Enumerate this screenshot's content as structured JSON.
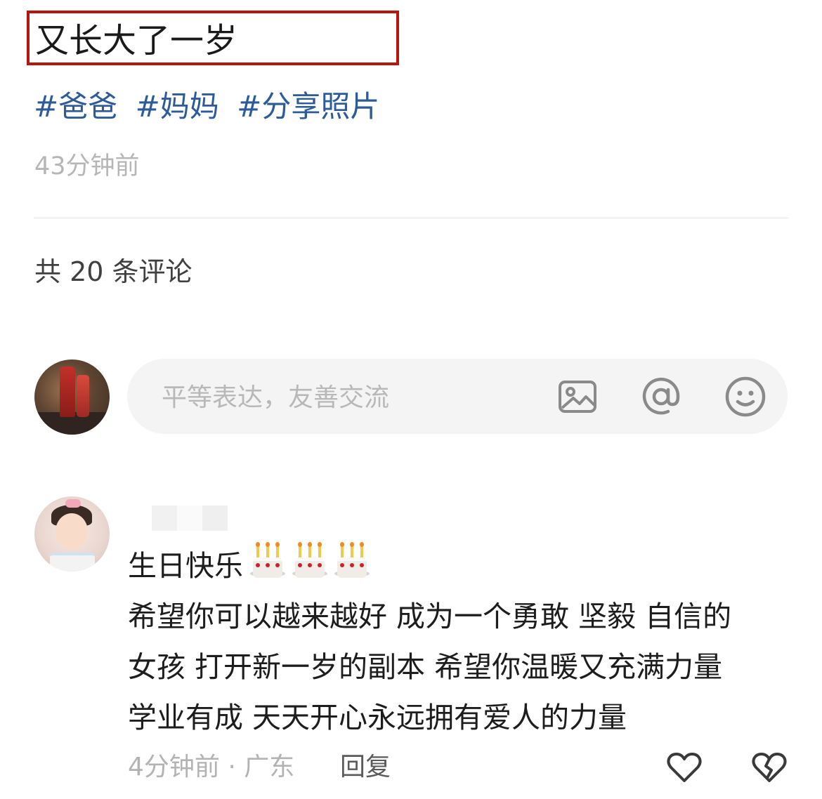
{
  "post": {
    "title": "又长大了一岁",
    "tags": [
      "#爸爸",
      "#妈妈",
      "#分享照片"
    ],
    "time": "43分钟前"
  },
  "comments": {
    "count_label": "共 20 条评论",
    "input_placeholder": "平等表达，友善交流",
    "icons": {
      "image": "image-icon",
      "mention": "at-mention-icon",
      "emoji": "emoji-smile-icon"
    },
    "items": [
      {
        "first_line": "生日快乐",
        "emoji": [
          "🎂",
          "🎂",
          "🎂"
        ],
        "lines": [
          "希望你可以越来越好 成为一个勇敢 坚毅 自信的",
          "女孩 打开新一岁的副本 希望你温暖又充满力量",
          "学业有成 天天开心永远拥有爱人的力量"
        ],
        "meta": "4分钟前 · 广东",
        "reply_label": "回复",
        "actions": [
          "heart-icon",
          "broken-heart-icon"
        ]
      }
    ]
  },
  "colors": {
    "highlight_border": "#b8150f",
    "tag": "#2d5a9a",
    "muted": "#b6b6b6"
  }
}
